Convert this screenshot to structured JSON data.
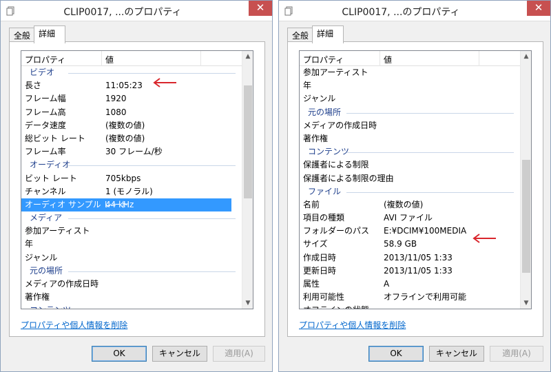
{
  "windows": [
    {
      "title": "CLIP0017, ...のプロパティ",
      "close_label": "✕",
      "tabs": [
        {
          "label": "全般"
        },
        {
          "label": "詳細"
        }
      ],
      "header": {
        "prop": "プロパティ",
        "value": "値"
      },
      "rows": [
        {
          "type": "group",
          "k": "ビデオ"
        },
        {
          "k": "長さ",
          "v": "11:05:23"
        },
        {
          "k": "フレーム幅",
          "v": "1920"
        },
        {
          "k": "フレーム高",
          "v": "1080"
        },
        {
          "k": "データ速度",
          "v": "(複数の値)"
        },
        {
          "k": "総ビット レート",
          "v": "(複数の値)"
        },
        {
          "k": "フレーム率",
          "v": "30 フレーム/秒"
        },
        {
          "type": "group",
          "k": "オーディオ"
        },
        {
          "k": "ビット レート",
          "v": "705kbps"
        },
        {
          "k": "チャンネル",
          "v": "1 (モノラル)"
        },
        {
          "k": "オーディオ サンプル レート",
          "v": "44 kHz",
          "selected": true
        },
        {
          "type": "group",
          "k": "メディア"
        },
        {
          "k": "参加アーティスト",
          "v": ""
        },
        {
          "k": "年",
          "v": ""
        },
        {
          "k": "ジャンル",
          "v": ""
        },
        {
          "type": "group",
          "k": "元の場所"
        },
        {
          "k": "メディアの作成日時",
          "v": ""
        },
        {
          "k": "著作権",
          "v": ""
        },
        {
          "type": "group",
          "k": "コンテンツ"
        }
      ],
      "remove_link": "プロパティや個人情報を削除",
      "buttons": {
        "ok": "OK",
        "cancel": "キャンセル",
        "apply": "適用(A)"
      }
    },
    {
      "title": "CLIP0017, ...のプロパティ",
      "close_label": "✕",
      "tabs": [
        {
          "label": "全般"
        },
        {
          "label": "詳細"
        }
      ],
      "header": {
        "prop": "プロパティ",
        "value": "値"
      },
      "rows": [
        {
          "k": "参加アーティスト",
          "v": ""
        },
        {
          "k": "年",
          "v": ""
        },
        {
          "k": "ジャンル",
          "v": ""
        },
        {
          "type": "group",
          "k": "元の場所"
        },
        {
          "k": "メディアの作成日時",
          "v": ""
        },
        {
          "k": "著作権",
          "v": ""
        },
        {
          "type": "group",
          "k": "コンテンツ"
        },
        {
          "k": "保護者による制限",
          "v": ""
        },
        {
          "k": "保護者による制限の理由",
          "v": ""
        },
        {
          "type": "group",
          "k": "ファイル"
        },
        {
          "k": "名前",
          "v": "(複数の値)"
        },
        {
          "k": "項目の種類",
          "v": "AVI ファイル"
        },
        {
          "k": "フォルダーのパス",
          "v": "E:¥DCIM¥100MEDIA"
        },
        {
          "k": "サイズ",
          "v": "58.9 GB"
        },
        {
          "k": "作成日時",
          "v": "2013/11/05 1:33"
        },
        {
          "k": "更新日時",
          "v": "2013/11/05 1:33"
        },
        {
          "k": "属性",
          "v": "A"
        },
        {
          "k": "利用可能性",
          "v": "オフラインで利用可能"
        },
        {
          "k": "オフラインの状態",
          "v": ""
        }
      ],
      "remove_link": "プロパティや個人情報を削除",
      "buttons": {
        "ok": "OK",
        "cancel": "キャンセル",
        "apply": "適用(A)"
      }
    }
  ],
  "colors": {
    "accent_arrow": "#d9262c",
    "selection": "#3399ff",
    "group_text": "#1e3f8c",
    "link": "#0066cc"
  },
  "icons": {
    "arrow": "left-arrow-annotation",
    "scroll_up": "chevron-up",
    "scroll_down": "chevron-down"
  }
}
